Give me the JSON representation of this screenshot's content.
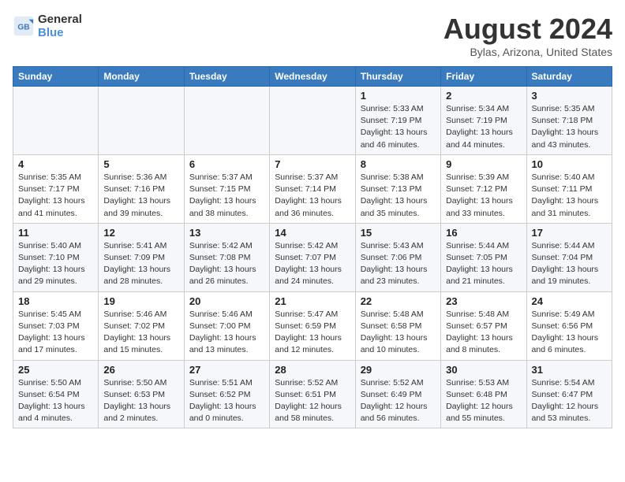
{
  "header": {
    "logo_line1": "General",
    "logo_line2": "Blue",
    "month": "August 2024",
    "location": "Bylas, Arizona, United States"
  },
  "weekdays": [
    "Sunday",
    "Monday",
    "Tuesday",
    "Wednesday",
    "Thursday",
    "Friday",
    "Saturday"
  ],
  "weeks": [
    [
      {
        "day": "",
        "info": ""
      },
      {
        "day": "",
        "info": ""
      },
      {
        "day": "",
        "info": ""
      },
      {
        "day": "",
        "info": ""
      },
      {
        "day": "1",
        "info": "Sunrise: 5:33 AM\nSunset: 7:19 PM\nDaylight: 13 hours\nand 46 minutes."
      },
      {
        "day": "2",
        "info": "Sunrise: 5:34 AM\nSunset: 7:19 PM\nDaylight: 13 hours\nand 44 minutes."
      },
      {
        "day": "3",
        "info": "Sunrise: 5:35 AM\nSunset: 7:18 PM\nDaylight: 13 hours\nand 43 minutes."
      }
    ],
    [
      {
        "day": "4",
        "info": "Sunrise: 5:35 AM\nSunset: 7:17 PM\nDaylight: 13 hours\nand 41 minutes."
      },
      {
        "day": "5",
        "info": "Sunrise: 5:36 AM\nSunset: 7:16 PM\nDaylight: 13 hours\nand 39 minutes."
      },
      {
        "day": "6",
        "info": "Sunrise: 5:37 AM\nSunset: 7:15 PM\nDaylight: 13 hours\nand 38 minutes."
      },
      {
        "day": "7",
        "info": "Sunrise: 5:37 AM\nSunset: 7:14 PM\nDaylight: 13 hours\nand 36 minutes."
      },
      {
        "day": "8",
        "info": "Sunrise: 5:38 AM\nSunset: 7:13 PM\nDaylight: 13 hours\nand 35 minutes."
      },
      {
        "day": "9",
        "info": "Sunrise: 5:39 AM\nSunset: 7:12 PM\nDaylight: 13 hours\nand 33 minutes."
      },
      {
        "day": "10",
        "info": "Sunrise: 5:40 AM\nSunset: 7:11 PM\nDaylight: 13 hours\nand 31 minutes."
      }
    ],
    [
      {
        "day": "11",
        "info": "Sunrise: 5:40 AM\nSunset: 7:10 PM\nDaylight: 13 hours\nand 29 minutes."
      },
      {
        "day": "12",
        "info": "Sunrise: 5:41 AM\nSunset: 7:09 PM\nDaylight: 13 hours\nand 28 minutes."
      },
      {
        "day": "13",
        "info": "Sunrise: 5:42 AM\nSunset: 7:08 PM\nDaylight: 13 hours\nand 26 minutes."
      },
      {
        "day": "14",
        "info": "Sunrise: 5:42 AM\nSunset: 7:07 PM\nDaylight: 13 hours\nand 24 minutes."
      },
      {
        "day": "15",
        "info": "Sunrise: 5:43 AM\nSunset: 7:06 PM\nDaylight: 13 hours\nand 23 minutes."
      },
      {
        "day": "16",
        "info": "Sunrise: 5:44 AM\nSunset: 7:05 PM\nDaylight: 13 hours\nand 21 minutes."
      },
      {
        "day": "17",
        "info": "Sunrise: 5:44 AM\nSunset: 7:04 PM\nDaylight: 13 hours\nand 19 minutes."
      }
    ],
    [
      {
        "day": "18",
        "info": "Sunrise: 5:45 AM\nSunset: 7:03 PM\nDaylight: 13 hours\nand 17 minutes."
      },
      {
        "day": "19",
        "info": "Sunrise: 5:46 AM\nSunset: 7:02 PM\nDaylight: 13 hours\nand 15 minutes."
      },
      {
        "day": "20",
        "info": "Sunrise: 5:46 AM\nSunset: 7:00 PM\nDaylight: 13 hours\nand 13 minutes."
      },
      {
        "day": "21",
        "info": "Sunrise: 5:47 AM\nSunset: 6:59 PM\nDaylight: 13 hours\nand 12 minutes."
      },
      {
        "day": "22",
        "info": "Sunrise: 5:48 AM\nSunset: 6:58 PM\nDaylight: 13 hours\nand 10 minutes."
      },
      {
        "day": "23",
        "info": "Sunrise: 5:48 AM\nSunset: 6:57 PM\nDaylight: 13 hours\nand 8 minutes."
      },
      {
        "day": "24",
        "info": "Sunrise: 5:49 AM\nSunset: 6:56 PM\nDaylight: 13 hours\nand 6 minutes."
      }
    ],
    [
      {
        "day": "25",
        "info": "Sunrise: 5:50 AM\nSunset: 6:54 PM\nDaylight: 13 hours\nand 4 minutes."
      },
      {
        "day": "26",
        "info": "Sunrise: 5:50 AM\nSunset: 6:53 PM\nDaylight: 13 hours\nand 2 minutes."
      },
      {
        "day": "27",
        "info": "Sunrise: 5:51 AM\nSunset: 6:52 PM\nDaylight: 13 hours\nand 0 minutes."
      },
      {
        "day": "28",
        "info": "Sunrise: 5:52 AM\nSunset: 6:51 PM\nDaylight: 12 hours\nand 58 minutes."
      },
      {
        "day": "29",
        "info": "Sunrise: 5:52 AM\nSunset: 6:49 PM\nDaylight: 12 hours\nand 56 minutes."
      },
      {
        "day": "30",
        "info": "Sunrise: 5:53 AM\nSunset: 6:48 PM\nDaylight: 12 hours\nand 55 minutes."
      },
      {
        "day": "31",
        "info": "Sunrise: 5:54 AM\nSunset: 6:47 PM\nDaylight: 12 hours\nand 53 minutes."
      }
    ]
  ]
}
